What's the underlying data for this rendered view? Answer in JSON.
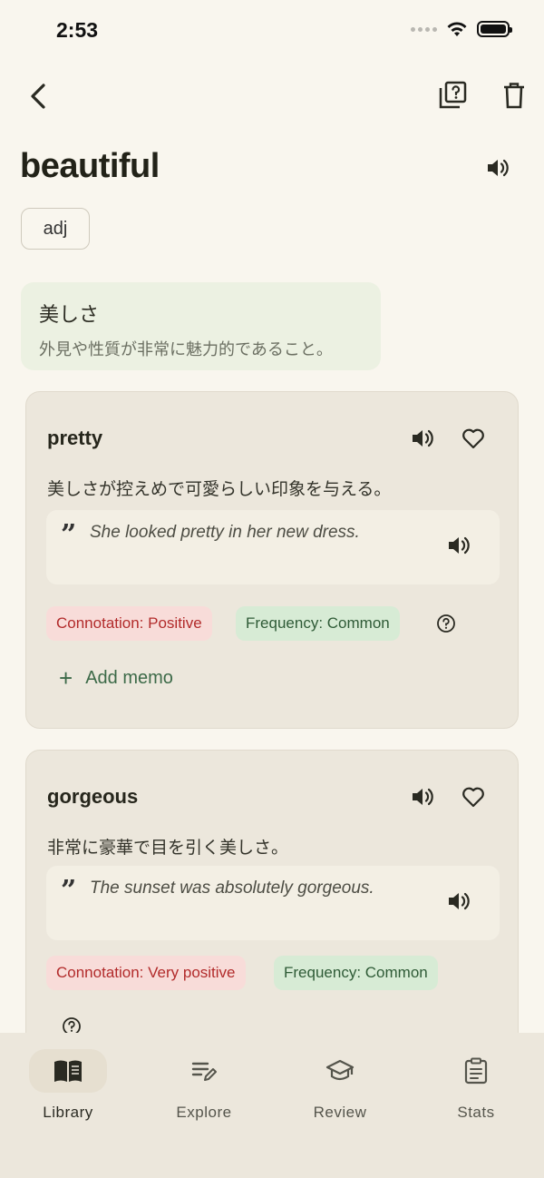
{
  "status_bar": {
    "time": "2:53"
  },
  "word": {
    "title": "beautiful",
    "part_of_speech": "adj",
    "meaning_title": "美しさ",
    "meaning_desc": "外見や性質が非常に魅力的であること。"
  },
  "synonyms": [
    {
      "word": "pretty",
      "meaning": "美しさが控えめで可愛らしい印象を与える。",
      "example": "She looked pretty in her new dress.",
      "connotation": "Connotation: Positive",
      "frequency": "Frequency: Common",
      "add_memo": "Add memo"
    },
    {
      "word": "gorgeous",
      "meaning": "非常に豪華で目を引く美しさ。",
      "example": "The sunset was absolutely gorgeous.",
      "connotation": "Connotation: Very positive",
      "frequency": "Frequency: Common"
    }
  ],
  "nav": {
    "items": [
      {
        "label": "Library",
        "icon": "book-icon",
        "active": true
      },
      {
        "label": "Explore",
        "icon": "edit-list-icon"
      },
      {
        "label": "Review",
        "icon": "graduation-cap-icon"
      },
      {
        "label": "Stats",
        "icon": "clipboard-icon"
      }
    ]
  },
  "colors": {
    "background": "#f9f6ee",
    "card": "#ece7dc",
    "meaning_box": "#ecf1e2",
    "connotation_bg": "#f8dcd9",
    "connotation_text": "#b22b2b",
    "frequency_bg": "#d7ebd5",
    "frequency_text": "#2f5b37",
    "accent_green": "#3c6a48"
  }
}
